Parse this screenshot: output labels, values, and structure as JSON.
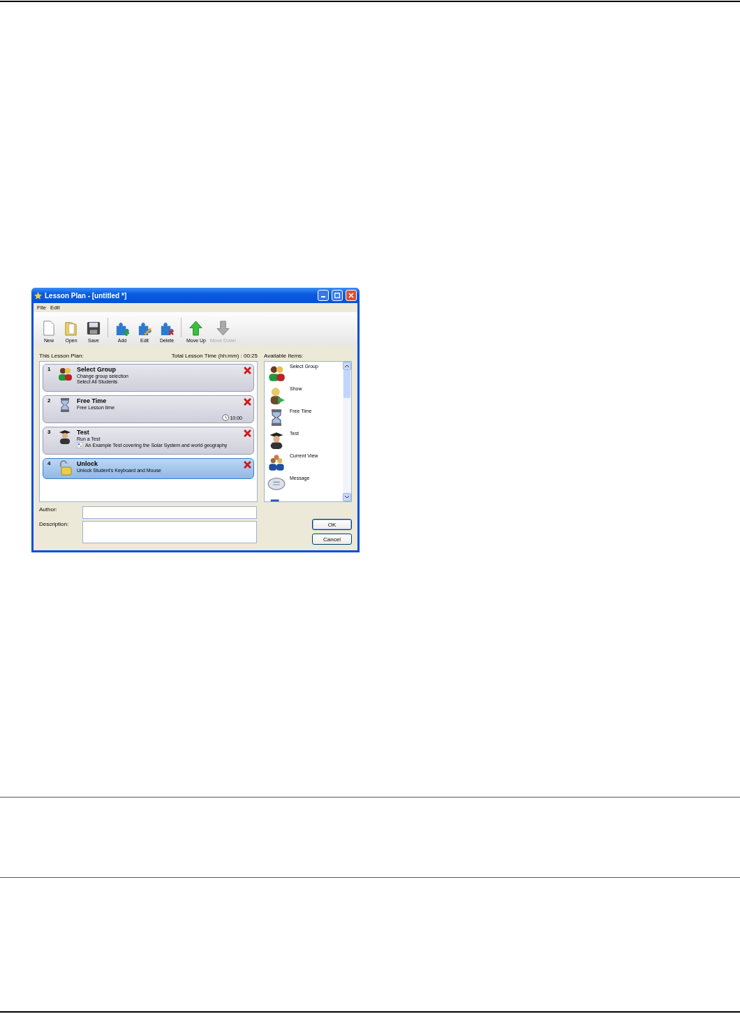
{
  "window": {
    "title": "Lesson Plan - [untitled *]"
  },
  "menu": [
    {
      "label": "File"
    },
    {
      "label": "Edit"
    }
  ],
  "toolbar": [
    [
      {
        "kind": "new",
        "label": "New",
        "disabled": false
      },
      {
        "kind": "open",
        "label": "Open",
        "disabled": false
      },
      {
        "kind": "save",
        "label": "Save",
        "disabled": false
      }
    ],
    [
      {
        "kind": "add",
        "label": "Add",
        "disabled": false
      },
      {
        "kind": "edit",
        "label": "Edit",
        "disabled": false
      },
      {
        "kind": "delete",
        "label": "Delete",
        "disabled": false
      }
    ],
    [
      {
        "kind": "up",
        "label": "Move Up",
        "disabled": false
      },
      {
        "kind": "down",
        "label": "Move Down",
        "disabled": true
      }
    ]
  ],
  "plan": {
    "label": "This Lesson Plan:",
    "total": "Total Lesson Time (hh:mm) : 00:25",
    "items": [
      {
        "number": "1",
        "kind": "group",
        "title": "Select Group",
        "subtitle": "Change group selection",
        "detail": "Select All Students",
        "selected": false
      },
      {
        "number": "2",
        "kind": "hourglass",
        "title": "Free Time",
        "subtitle": "Free Lesson time",
        "time": "10:00",
        "selected": false
      },
      {
        "number": "3",
        "kind": "test",
        "title": "Test",
        "subtitle": "Run a Test",
        "detail": "An Example Test covering the Solar System and world geography",
        "detail_icon": true,
        "selected": false
      },
      {
        "number": "4",
        "kind": "unlock",
        "title": "Unlock",
        "subtitle": "Unlock Student's Keyboard and Mouse",
        "selected": true
      }
    ]
  },
  "available": {
    "label": "Available Items:",
    "items": [
      {
        "kind": "group",
        "label": "Select Group"
      },
      {
        "kind": "show",
        "label": "Show"
      },
      {
        "kind": "hourglass",
        "label": "Free Time"
      },
      {
        "kind": "test",
        "label": "Test"
      },
      {
        "kind": "people",
        "label": "Current View"
      },
      {
        "kind": "message",
        "label": "Message"
      },
      {
        "kind": "monitor"
      }
    ]
  },
  "fields": [
    {
      "label": "Author:",
      "kind": "line"
    },
    {
      "label": "Description:",
      "kind": "area"
    }
  ],
  "buttons": [
    {
      "label": "OK",
      "default": true
    },
    {
      "label": "Cancel",
      "default": false
    }
  ]
}
